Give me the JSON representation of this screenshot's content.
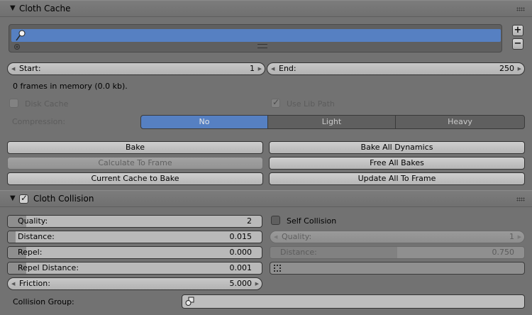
{
  "cache_panel": {
    "title": "Cloth Cache",
    "start": {
      "label": "Start:",
      "value": "1"
    },
    "end": {
      "label": "End:",
      "value": "250"
    },
    "memory_info": "0 frames in memory (0.0 kb).",
    "disk_cache": {
      "label": "Disk Cache",
      "checked": false
    },
    "use_lib_path": {
      "label": "Use Lib Path",
      "checked": true
    },
    "compression": {
      "label": "Compression:",
      "options": [
        "No",
        "Light",
        "Heavy"
      ],
      "selected": "No"
    },
    "buttons": {
      "bake": "Bake",
      "bake_all": "Bake All Dynamics",
      "calc_frame": "Calculate To Frame",
      "free_all": "Free All Bakes",
      "current_to_bake": "Current Cache to Bake",
      "update_all": "Update All To Frame"
    },
    "add_symbol": "+",
    "remove_symbol": "−"
  },
  "collision_panel": {
    "title": "Cloth Collision",
    "enabled": true,
    "quality": {
      "label": "Quality:",
      "value": "2"
    },
    "distance": {
      "label": "Distance:",
      "value": "0.015",
      "fraction": 0.03
    },
    "repel": {
      "label": "Repel:",
      "value": "0.000",
      "fraction": 0.0
    },
    "repel_distance": {
      "label": "Repel Distance:",
      "value": "0.001",
      "fraction": 0.0
    },
    "friction": {
      "label": "Friction:",
      "value": "5.000"
    },
    "self_collision": {
      "label": "Self Collision",
      "checked": false
    },
    "self_quality": {
      "label": "Quality:",
      "value": "1"
    },
    "self_distance": {
      "label": "Distance:",
      "value": "0.750",
      "fraction": 0.5
    },
    "collision_group_label": "Collision Group:"
  },
  "colors": {
    "accent": "#5680c2",
    "panel": "#727272"
  }
}
